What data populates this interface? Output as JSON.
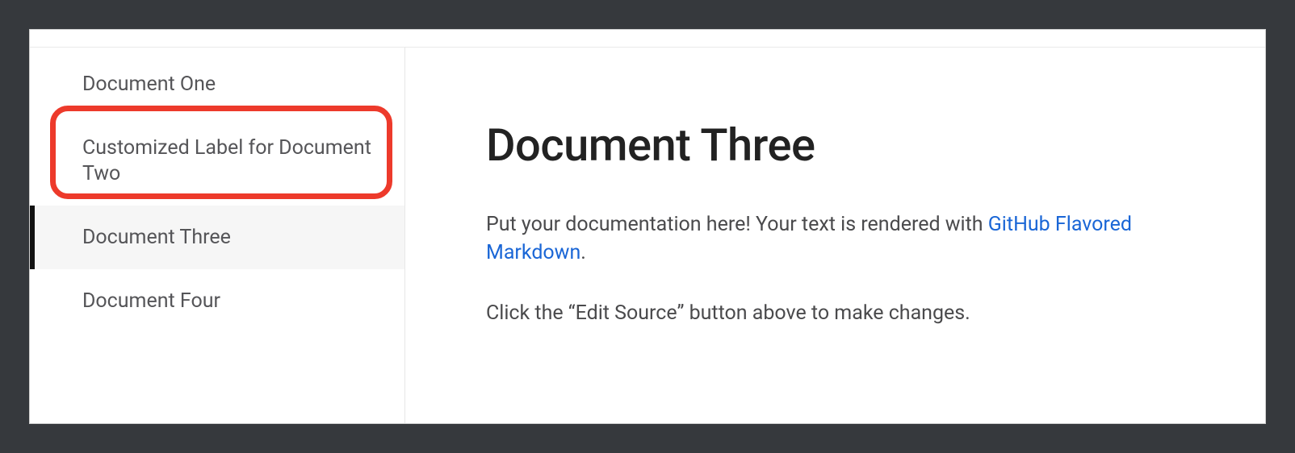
{
  "sidebar": {
    "items": [
      {
        "label": "Document One",
        "active": false
      },
      {
        "label": "Customized Label for Document Two",
        "active": false
      },
      {
        "label": "Document Three",
        "active": true
      },
      {
        "label": "Document Four",
        "active": false
      }
    ]
  },
  "main": {
    "heading": "Document Three",
    "paragraph1_before": "Put your documentation here! Your text is rendered with ",
    "paragraph1_link": "GitHub Flavored Markdown",
    "paragraph1_after": ".",
    "paragraph2": "Click the “Edit Source” button above to make changes."
  }
}
